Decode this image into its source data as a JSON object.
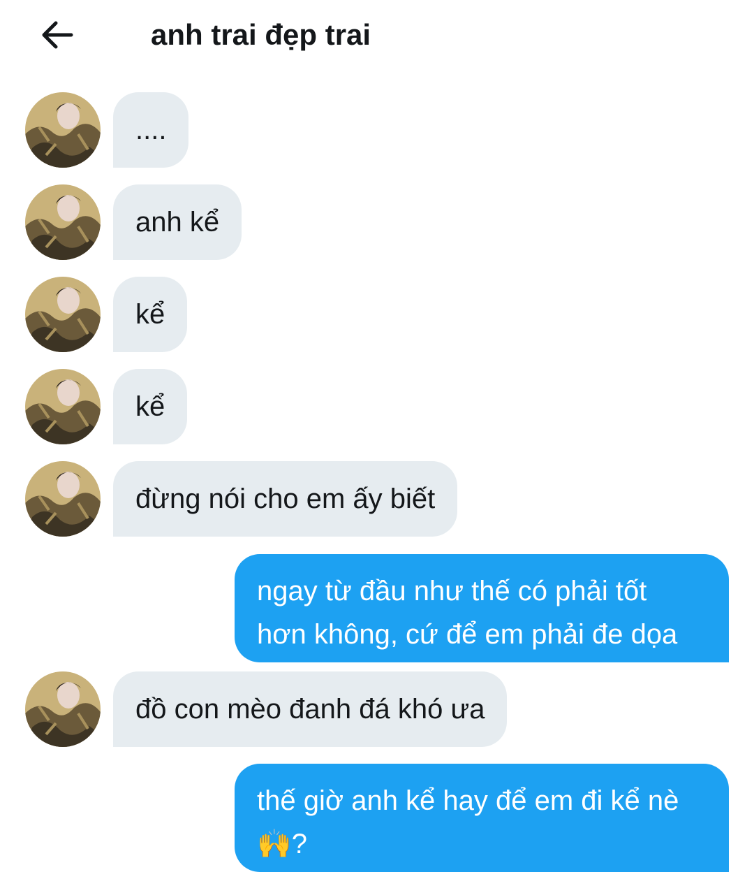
{
  "header": {
    "back_icon": "arrow-left-icon",
    "title": "anh trai đẹp trai"
  },
  "messages": [
    {
      "side": "received",
      "text": "...."
    },
    {
      "side": "received",
      "text": "anh kể"
    },
    {
      "side": "received",
      "text": "kể"
    },
    {
      "side": "received",
      "text": "kể"
    },
    {
      "side": "received",
      "text": "đừng nói cho em ấy biết"
    },
    {
      "side": "sent",
      "text": "ngay từ đầu như thế có phải tốt\nhơn không, cứ để em phải đe dọa"
    },
    {
      "side": "received",
      "text": "đồ con mèo đanh đá khó ưa"
    },
    {
      "side": "sent",
      "text": "thế giờ anh kể hay để em đi kể nè\n🙌?"
    }
  ],
  "colors": {
    "received_bubble": "#e6ecf0",
    "sent_bubble": "#1da1f2",
    "sent_text": "#ffffff",
    "text": "#14171a"
  }
}
